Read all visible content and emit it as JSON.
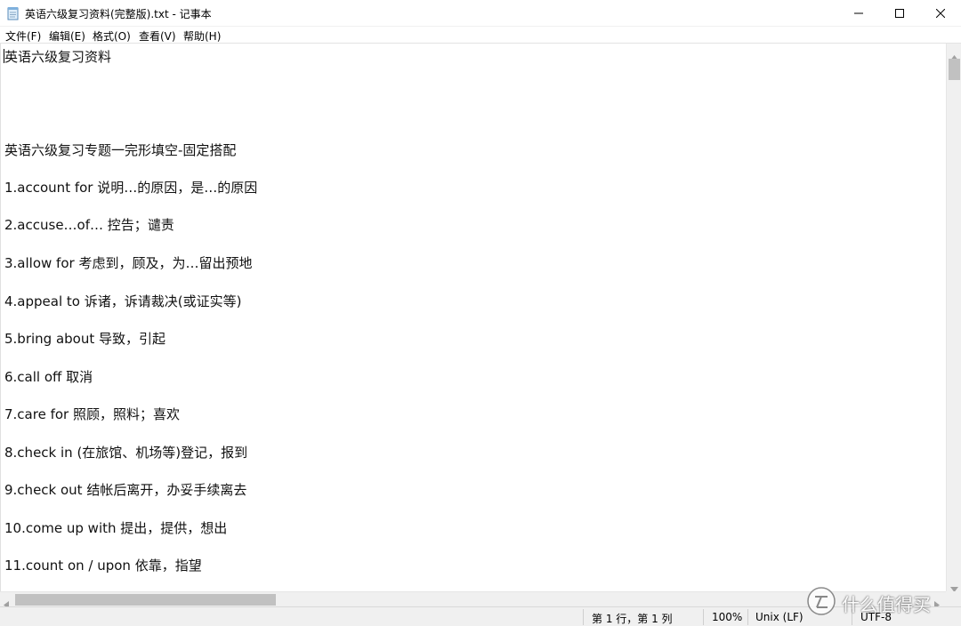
{
  "window": {
    "title": "英语六级复习资料(完整版).txt - 记事本",
    "icon": "notepad-icon"
  },
  "menu": [
    {
      "label": "文件(F)"
    },
    {
      "label": "编辑(E)"
    },
    {
      "label": "格式(O)"
    },
    {
      "label": "查看(V)"
    },
    {
      "label": "帮助(H)"
    }
  ],
  "document": {
    "lines": [
      "英语六级复习资料",
      "英语六级复习专题一完形填空-固定搭配",
      "1.account for 说明…的原因，是…的原因",
      "2.accuse…of… 控告；谴责",
      "3.allow for 考虑到，顾及，为…留出预地",
      "4.appeal to 诉诸，诉请裁决(或证实等)",
      "5.bring about 导致，引起",
      "6.call off 取消",
      "7.care for 照顾，照料；喜欢",
      "8.check in (在旅馆、机场等)登记，报到",
      "9.check out 结帐后离开，办妥手续离去",
      "10.come up with 提出，提供，想出",
      "11.count on / upon 依靠，指望"
    ]
  },
  "status": {
    "position": "第 1 行，第 1 列",
    "zoom": "100%",
    "line_ending": "Unix (LF)",
    "encoding": "UTF-8"
  },
  "watermark": {
    "text": "什么值得买",
    "icon": "zhi-logo-icon"
  },
  "scroll": {
    "vertical_position_fraction": 0.0,
    "horizontal_position_fraction": 0.0
  }
}
